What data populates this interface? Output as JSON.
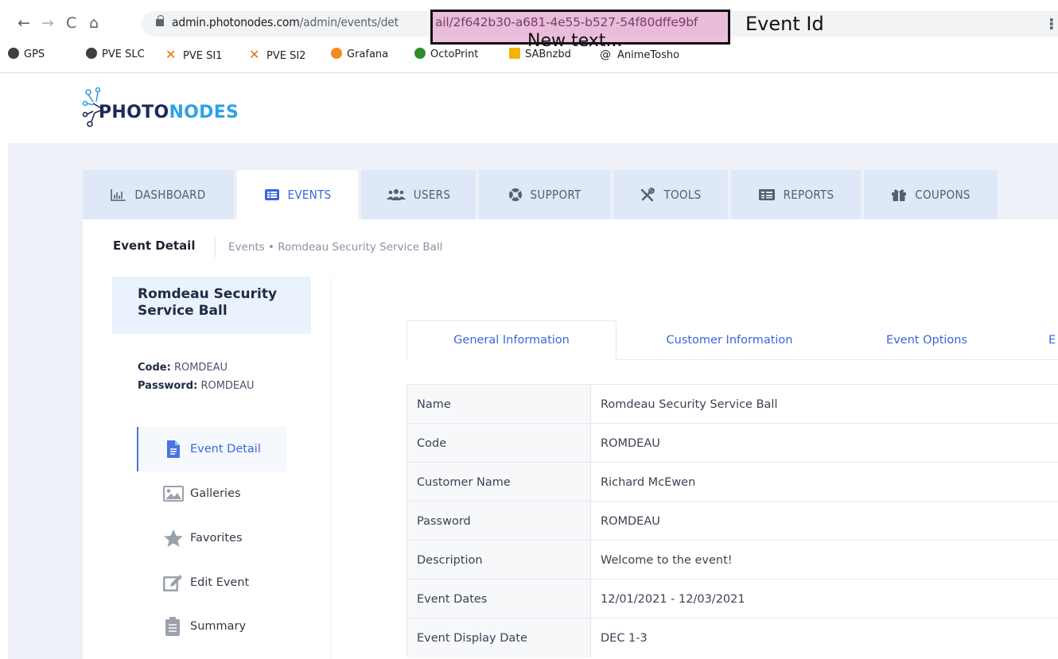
{
  "browser": {
    "url_host": "admin.photonodes.com",
    "url_path": "/admin/events/det",
    "url_tail": "ail/2f642b30-a681-4e55-b527-54f80dffe9bf",
    "annotation_label": "Event Id",
    "annotation_note": "New text...",
    "bookmarks": [
      "GPS",
      "PVE SLC",
      "PVE SI1",
      "PVE SI2",
      "Grafana",
      "OctoPrint",
      "SABnzbd",
      "AnimeTosho"
    ]
  },
  "brand": {
    "part1": "PHOTO",
    "part2": "NODES"
  },
  "nav": {
    "tabs": [
      "DASHBOARD",
      "EVENTS",
      "USERS",
      "SUPPORT",
      "TOOLS",
      "REPORTS",
      "COUPONS"
    ]
  },
  "breadcrumb": {
    "title": "Event Detail",
    "path": "Events • Romdeau Security Service Ball"
  },
  "sidebar": {
    "event_name": "Romdeau Security Service Ball",
    "code_label": "Code:",
    "code_value": "ROMDEAU",
    "password_label": "Password:",
    "password_value": "ROMDEAU",
    "items": [
      "Event Detail",
      "Galleries",
      "Favorites",
      "Edit Event",
      "Summary"
    ]
  },
  "detail_tabs": [
    "General Information",
    "Customer Information",
    "Event Options",
    "E"
  ],
  "details": [
    {
      "key": "Name",
      "value": "Romdeau Security Service Ball"
    },
    {
      "key": "Code",
      "value": "ROMDEAU"
    },
    {
      "key": "Customer Name",
      "value": "Richard McEwen"
    },
    {
      "key": "Password",
      "value": "ROMDEAU"
    },
    {
      "key": "Description",
      "value": "Welcome to the event!"
    },
    {
      "key": "Event Dates",
      "value": "12/01/2021 - 12/03/2021"
    },
    {
      "key": "Event Display Date",
      "value": "DEC 1-3"
    }
  ],
  "colors": {
    "accent": "#3a66d8",
    "brand_dark": "#1d2a5a",
    "brand_light": "#2fa1e6",
    "band": "#eef1f7",
    "tab_bg": "#dfe8f7"
  }
}
